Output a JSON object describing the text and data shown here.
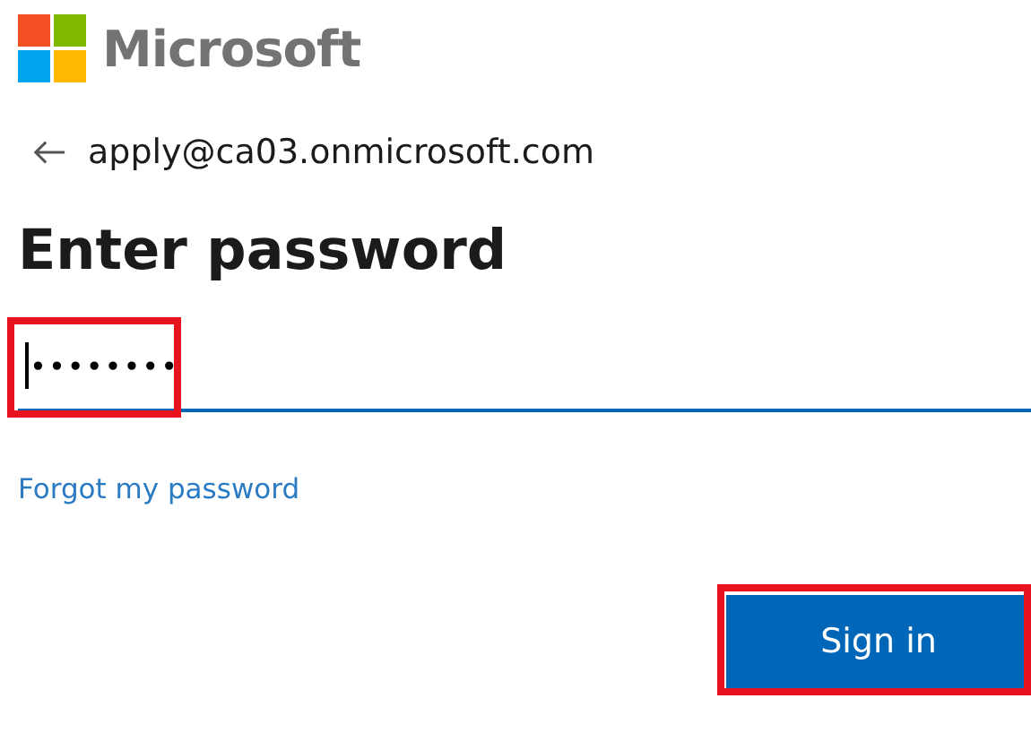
{
  "brand": {
    "name": "Microsoft"
  },
  "account": {
    "email": "apply@ca03.onmicrosoft.com"
  },
  "title": "Enter password",
  "password_field": {
    "value": "••••••••",
    "highlighted": true
  },
  "forgot_link": "Forgot my password",
  "sign_in_button": {
    "label": "Sign in",
    "highlighted": true
  }
}
